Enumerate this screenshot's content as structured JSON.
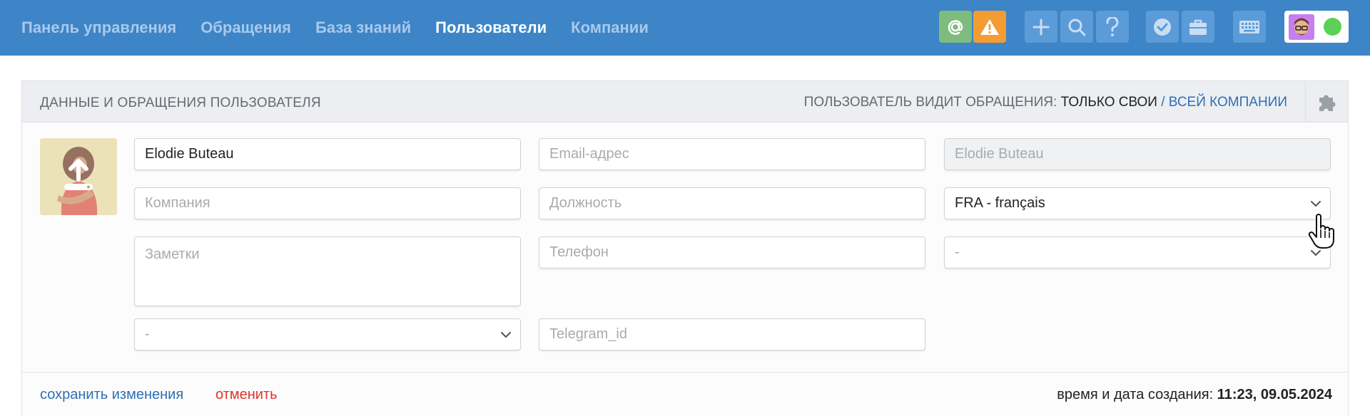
{
  "nav": {
    "items": [
      {
        "label": "Панель управления",
        "active": false
      },
      {
        "label": "Обращения",
        "active": false
      },
      {
        "label": "База знаний",
        "active": false
      },
      {
        "label": "Пользователи",
        "active": true
      },
      {
        "label": "Компании",
        "active": false
      }
    ]
  },
  "toolbar": {
    "icons": [
      "at-icon",
      "warning-icon",
      "plus-icon",
      "search-icon",
      "help-icon",
      "badge-check-icon",
      "briefcase-icon",
      "keyboard-icon"
    ],
    "status_color": "#5cd155"
  },
  "card": {
    "title": "ДАННЫЕ И ОБРАЩЕНИЯ ПОЛЬЗОВАТЕЛЯ",
    "visibility_label": "ПОЛЬЗОВАТЕЛЬ ВИДИТ ОБРАЩЕНИЯ:",
    "visibility_own": "ТОЛЬКО СВОИ",
    "visibility_sep": "/",
    "visibility_company": "ВСЕЙ КОМПАНИИ"
  },
  "form": {
    "name_value": "Elodie Buteau",
    "email_placeholder": "Email-адрес",
    "display_name": "Elodie Buteau",
    "company_placeholder": "Компания",
    "position_placeholder": "Должность",
    "language_value": "FRA - français",
    "notes_placeholder": "Заметки",
    "phone_placeholder": "Телефон",
    "select_right_value": "-",
    "select_left_value": "-",
    "telegram_placeholder": "Telegram_id"
  },
  "footer": {
    "save_label": "сохранить изменения",
    "cancel_label": "отменить",
    "created_label": "время и дата создания:",
    "created_value": "11:23, 09.05.2024"
  }
}
